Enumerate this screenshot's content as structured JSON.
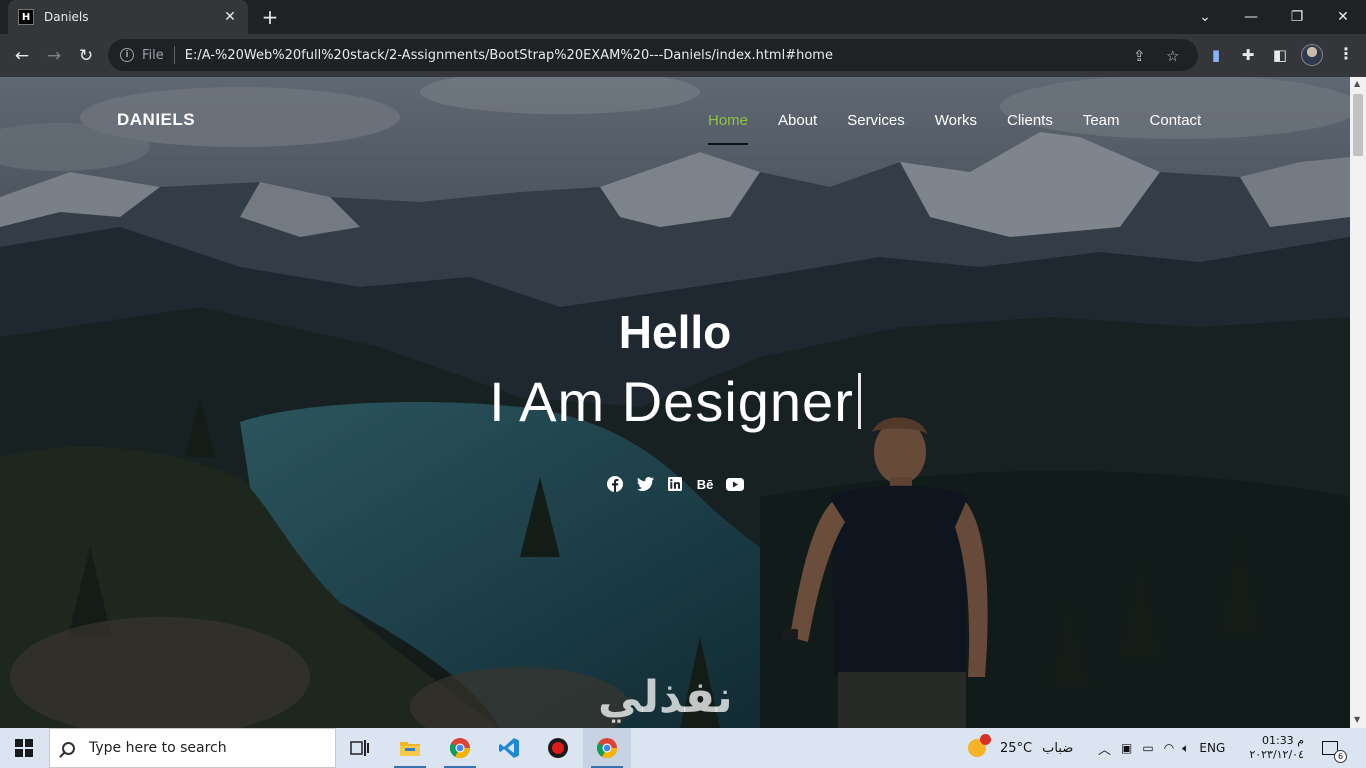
{
  "browser": {
    "tab_title": "Daniels",
    "tab_favicon": "H",
    "address_scheme": "File",
    "url": "E:/A-%20Web%20full%20stack/2-Assignments/BootStrap%20EXAM%20---Daniels/index.html#home"
  },
  "site": {
    "brand": "DANIELS",
    "nav": [
      {
        "label": "Home",
        "active": true
      },
      {
        "label": "About"
      },
      {
        "label": "Services"
      },
      {
        "label": "Works"
      },
      {
        "label": "Clients"
      },
      {
        "label": "Team"
      },
      {
        "label": "Contact"
      }
    ],
    "hero": {
      "greeting": "Hello",
      "tagline": "I Am Designer"
    },
    "socials": [
      "facebook-icon",
      "twitter-icon",
      "linkedin-icon",
      "behance-icon",
      "youtube-icon"
    ],
    "accent_color": "#8dc63f"
  },
  "watermark": "نفذلي",
  "taskbar": {
    "search_placeholder": "Type here to search",
    "weather_temp": "25°C",
    "weather_label": "ضباب",
    "language": "ENG",
    "time": "01:33 م",
    "date": "٢٠٢٣/١٢/٠٤",
    "notification_count": "6"
  }
}
